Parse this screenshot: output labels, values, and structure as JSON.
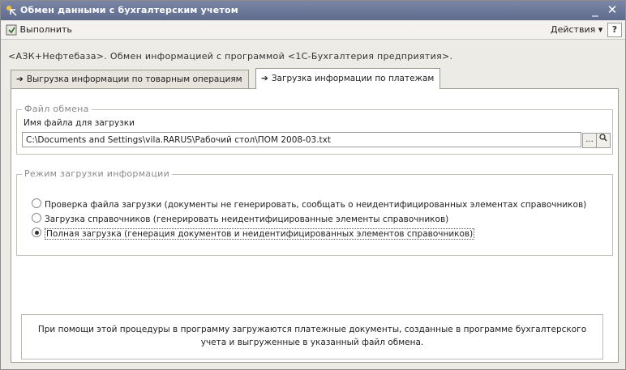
{
  "window": {
    "title": "Обмен данными с бухгалтерским учетом",
    "controls": {
      "minimize": "_",
      "close": "✕"
    }
  },
  "menubar": {
    "execute_label": "Выполнить",
    "actions_label": "Действия ▾",
    "help_label": "?"
  },
  "subtitle": "<АЗК+Нефтебаза>. Обмен информацией с программой <1С-Бухгалтерия предприятия>.",
  "tabs": [
    {
      "label": "Выгрузка информации по товарным операциям",
      "active": false
    },
    {
      "label": "Загрузка информации по платежам",
      "active": true
    }
  ],
  "file_group": {
    "title": "Файл обмена",
    "field_label": "Имя файла для загрузки",
    "file_path": "C:\\Documents and Settings\\vila.RARUS\\Рабочий стол\\ПОМ 2008-03.txt",
    "clear_button": "...",
    "open_button": "🔍"
  },
  "mode_group": {
    "title": "Режим загрузки информации",
    "options": [
      {
        "label": "Проверка файла загрузки (документы не генерировать, сообщать о неидентифицированных элементах справочников)",
        "selected": false
      },
      {
        "label": "Загрузка справочников (генерировать неидентифицированные элементы справочников)",
        "selected": false
      },
      {
        "label": "Полная загрузка (генерация документов и неидентифицированных элементов справочников)",
        "selected": true
      }
    ]
  },
  "info_text": "При помощи этой процедуры в программу загружаются платежные документы, созданные в программе бухгалтерского учета и выгруженные в указанный файл обмена.",
  "colors": {
    "titlebar": "#6b7697",
    "window_bg": "#ecebe6",
    "panel_bg": "#ffffff",
    "group_title": "#8a8a8a"
  }
}
